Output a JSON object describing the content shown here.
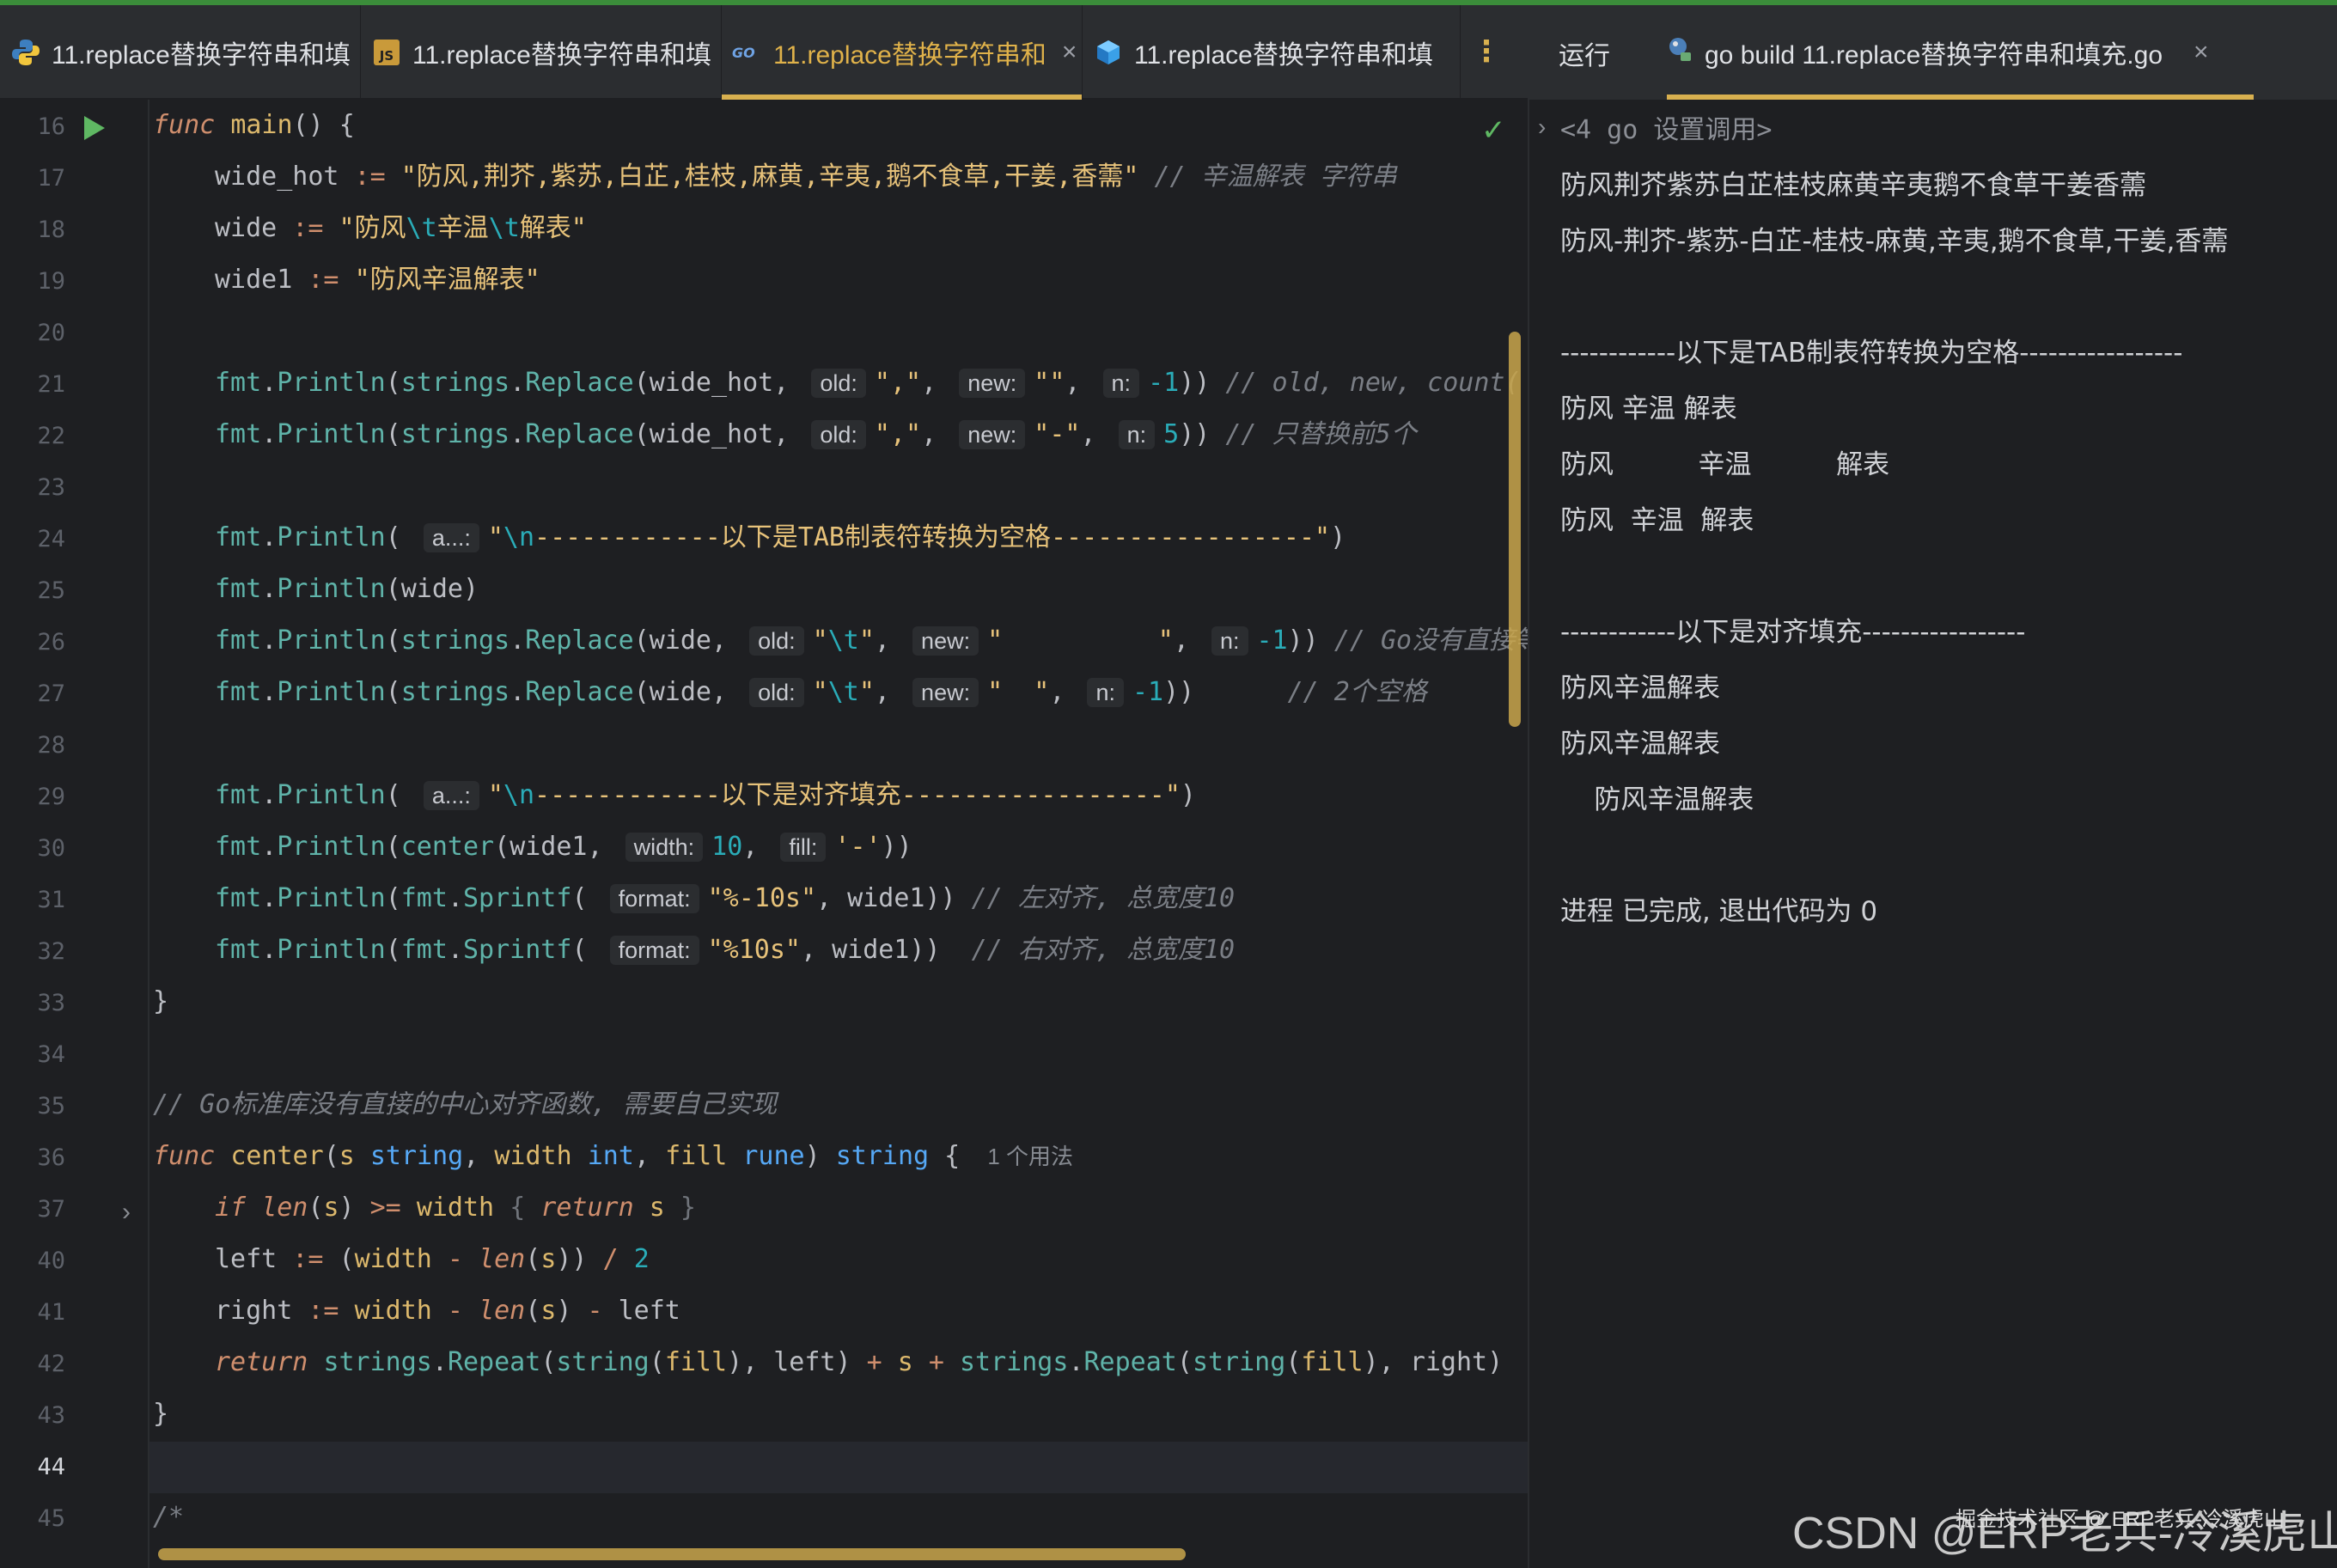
{
  "editor_tabs": [
    {
      "label": "11.replace替换字符串和填",
      "icon": "python-icon",
      "active": false
    },
    {
      "label": "11.replace替换字符串和填",
      "icon": "javascript-icon",
      "active": false
    },
    {
      "label": "11.replace替换字符串和",
      "icon": "go-icon",
      "active": true
    },
    {
      "label": "11.replace替换字符串和填",
      "icon": "cube-icon",
      "active": false
    }
  ],
  "editor_tab_close": "×",
  "editor_tab_menu": "⋮",
  "line_numbers": [
    "16",
    "17",
    "18",
    "19",
    "20",
    "21",
    "22",
    "23",
    "24",
    "25",
    "26",
    "27",
    "28",
    "29",
    "30",
    "31",
    "32",
    "33",
    "34",
    "35",
    "36",
    "37",
    "40",
    "41",
    "42",
    "43",
    "44",
    "45"
  ],
  "current_line": "44",
  "hints": {
    "old": "old:",
    "new": "new:",
    "n": "n:",
    "a": "a...:",
    "width": "width:",
    "fill": "fill:",
    "format": "format:",
    "usages": "1 个用法"
  },
  "code": {
    "l16": {
      "kw": "func",
      "name": "main",
      "rest": "() {"
    },
    "l17": {
      "var": "wide_hot",
      "op": " := ",
      "str": "\"防风,荆芥,紫苏,白芷,桂枝,麻黄,辛夷,鹅不食草,干姜,香薷\"",
      "cm": " // 辛温解表 字符串"
    },
    "l18": {
      "var": "wide",
      "op": " := ",
      "str_a": "\"防风",
      "esc1": "\\t",
      "str_b": "辛温",
      "esc2": "\\t",
      "str_c": "解表\""
    },
    "l19": {
      "var": "wide1",
      "op": " := ",
      "str": "\"防风辛温解表\""
    },
    "l21": {
      "fmt": "fmt",
      "println": "Println",
      "strings": "strings",
      "replace": "Replace",
      "arg1": "wide_hot",
      "old": "\",\"",
      "new": "\"\"",
      "n": "-1",
      "cm": "// old, new, count("
    },
    "l22": {
      "fmt": "fmt",
      "println": "Println",
      "strings": "strings",
      "replace": "Replace",
      "arg1": "wide_hot",
      "old": "\",\"",
      "new": "\"-\"",
      "n": "5",
      "cm": "// 只替换前5个"
    },
    "l24": {
      "fmt": "fmt",
      "println": "Println",
      "str_a": "\"",
      "esc": "\\n",
      "str_b": "------------以下是TAB制表符转换为空格-----------------\""
    },
    "l25": {
      "fmt": "fmt",
      "println": "Println",
      "arg": "wide"
    },
    "l26": {
      "fmt": "fmt",
      "println": "Println",
      "strings": "strings",
      "replace": "Replace",
      "arg1": "wide",
      "old_a": "\"",
      "old_esc": "\\t",
      "old_b": "\"",
      "new": "\"          \"",
      "n": "-1",
      "cm": "// Go没有直接等效"
    },
    "l27": {
      "fmt": "fmt",
      "println": "Println",
      "strings": "strings",
      "replace": "Replace",
      "arg1": "wide",
      "old_a": "\"",
      "old_esc": "\\t",
      "old_b": "\"",
      "new": "\"  \"",
      "n": "-1",
      "cm": "// 2个空格"
    },
    "l29": {
      "fmt": "fmt",
      "println": "Println",
      "str_a": "\"",
      "esc": "\\n",
      "str_b": "------------以下是对齐填充-----------------\""
    },
    "l30": {
      "fmt": "fmt",
      "println": "Println",
      "center": "center",
      "arg1": "wide1",
      "width": "10",
      "fill": "'-'"
    },
    "l31": {
      "fmt": "fmt",
      "println": "Println",
      "sprintf": "Sprintf",
      "format": "\"%-10s\"",
      "arg": "wide1",
      "cm": "// 左对齐, 总宽度10"
    },
    "l32": {
      "fmt": "fmt",
      "println": "Println",
      "sprintf": "Sprintf",
      "format": "\"%10s\"",
      "arg": "wide1",
      "cm": "// 右对齐, 总宽度10"
    },
    "l33": {
      "text": "}"
    },
    "l35": {
      "cm": "// Go标准库没有直接的中心对齐函数, 需要自己实现"
    },
    "l36": {
      "kw": "func",
      "name": "center",
      "p1": "s",
      "t1": "string",
      "p2": "width",
      "t2": "int",
      "p3": "fill",
      "t3": "rune",
      "ret": "string"
    },
    "l37": {
      "kw_if": "if",
      "len": "len",
      "arg": "s",
      "op": " >= ",
      "var": "width",
      "kw_ret": "return",
      "ret": "s"
    },
    "l40": {
      "var": "left",
      "op": " := ",
      "paren_open": "(",
      "w": "width",
      "minus": " - ",
      "len": "len",
      "arg": "s",
      "div": " / ",
      "num": "2"
    },
    "l41": {
      "var": "right",
      "op": " := ",
      "w": "width",
      "minus": " - ",
      "len": "len",
      "arg": "s",
      "minus2": " - ",
      "l": "left"
    },
    "l42": {
      "kw": "return",
      "strings": "strings",
      "repeat": "Repeat",
      "string": "string",
      "fill": "fill",
      "left": "left",
      "plus": " + ",
      "s": "s",
      "right": "right"
    },
    "l43": {
      "text": "}"
    },
    "l45": {
      "cm": "/*"
    }
  },
  "run": {
    "label": "运行",
    "tab_label": "go build 11.replace替换字符串和填充.go",
    "tab_close": "×",
    "output": [
      "<4 go 设置调用>",
      "防风荆芥紫苏白芷桂枝麻黄辛夷鹅不食草干姜香薷",
      "防风-荆芥-紫苏-白芷-桂枝-麻黄,辛夷,鹅不食草,干姜,香薷",
      "",
      "------------以下是TAB制表符转换为空格-----------------",
      "防风 辛温 解表",
      "防风          辛温          解表",
      "防风  辛温  解表",
      "",
      "------------以下是对齐填充-----------------",
      "防风辛温解表",
      "防风辛温解表",
      "    防风辛温解表",
      "",
      "进程 已完成, 退出代码为 0"
    ]
  },
  "watermark": "CSDN @ERP老兵-冷溪虎山",
  "watermark_small": "掘金技术社区 @ ERP老兵-冷溪虎山",
  "colors": {
    "accent": "#d8b04f",
    "keyword": "#cf8e6d",
    "string": "#6aab73",
    "function": "#56a8f5",
    "number": "#2aacb8",
    "comment": "#7a7e85"
  }
}
